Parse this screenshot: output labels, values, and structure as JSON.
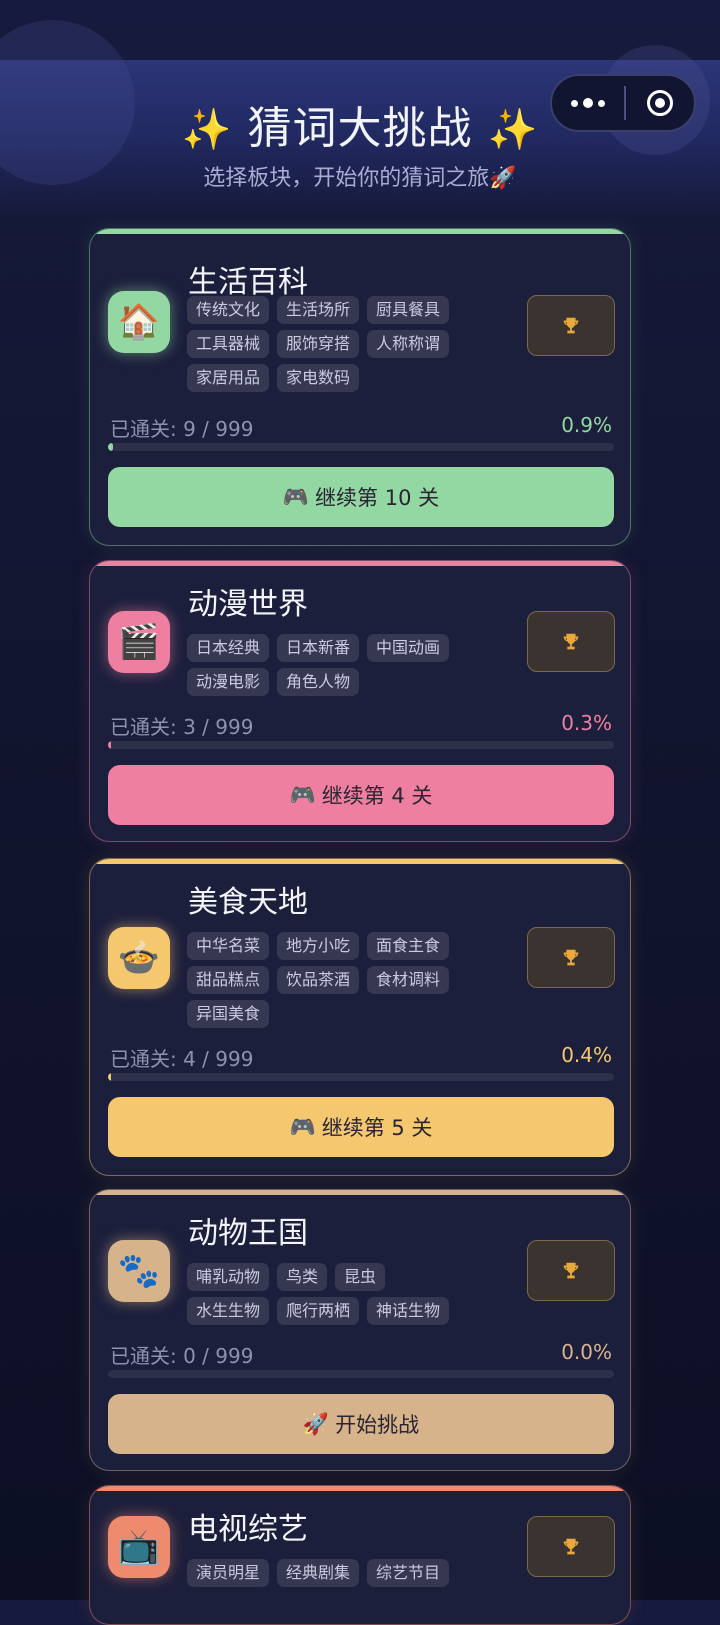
{
  "header": {
    "title": "猜词大挑战",
    "sparkle_icon": "sparkles-icon",
    "subtitle": "选择板块，开始你的猜词之旅🚀"
  },
  "capsule": {
    "more_icon": "more-dots-icon",
    "close_icon": "target-icon"
  },
  "categories": [
    {
      "name": "生活百科",
      "icon": "🏠",
      "color": "#93d8a3",
      "tags": [
        "传统文化",
        "生活场所",
        "厨具餐具",
        "工具器械",
        "服饰穿搭",
        "人称称谓",
        "家居用品",
        "家电数码"
      ],
      "progress_label": "已通关: 9 / 999",
      "progress_pct": "0.9%",
      "progress": 0.009,
      "button_icon": "🎮",
      "button_label": "继续第 10 关"
    },
    {
      "name": "动漫世界",
      "icon": "🎬",
      "color": "#ef7fa1",
      "tags": [
        "日本经典",
        "日本新番",
        "中国动画",
        "动漫电影",
        "角色人物"
      ],
      "progress_label": "已通关: 3 / 999",
      "progress_pct": "0.3%",
      "progress": 0.003,
      "button_icon": "🎮",
      "button_label": "继续第 4 关"
    },
    {
      "name": "美食天地",
      "icon": "🍲",
      "color": "#f5c76f",
      "tags": [
        "中华名菜",
        "地方小吃",
        "面食主食",
        "甜品糕点",
        "饮品茶酒",
        "食材调料",
        "异国美食"
      ],
      "progress_label": "已通关: 4 / 999",
      "progress_pct": "0.4%",
      "progress": 0.004,
      "button_icon": "🎮",
      "button_label": "继续第 5 关"
    },
    {
      "name": "动物王国",
      "icon": "🐾",
      "color": "#d6b38b",
      "tags": [
        "哺乳动物",
        "鸟类",
        "昆虫",
        "水生生物",
        "爬行两栖",
        "神话生物"
      ],
      "progress_label": "已通关: 0 / 999",
      "progress_pct": "0.0%",
      "progress": 0.0,
      "button_icon": "🚀",
      "button_label": "开始挑战"
    },
    {
      "name": "电视综艺",
      "icon": "📺",
      "color": "#ee8b6e",
      "tags": [
        "演员明星",
        "经典剧集",
        "综艺节目"
      ],
      "progress_label": "",
      "progress_pct": "",
      "progress": 0,
      "button_icon": "",
      "button_label": ""
    }
  ]
}
